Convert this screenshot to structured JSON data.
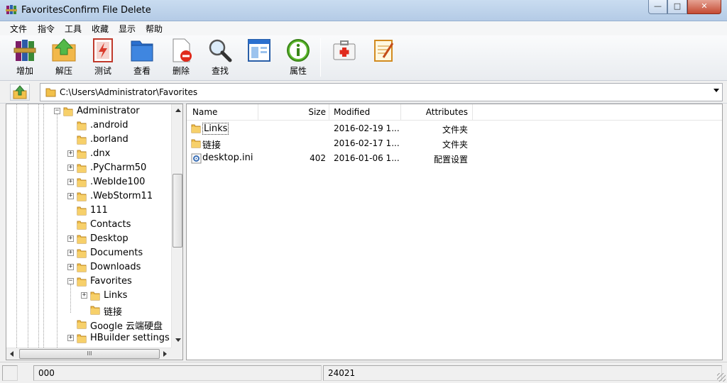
{
  "window": {
    "title": "FavoritesConfirm File Delete"
  },
  "menu": [
    "文件",
    "指令",
    "工具",
    "收藏",
    "显示",
    "帮助"
  ],
  "toolbar": {
    "buttons": [
      {
        "label": "增加",
        "icon": "books-add-icon"
      },
      {
        "label": "解压",
        "icon": "extract-folder-icon"
      },
      {
        "label": "测试",
        "icon": "test-document-icon"
      },
      {
        "label": "查看",
        "icon": "view-book-icon"
      },
      {
        "label": "删除",
        "icon": "delete-document-icon"
      },
      {
        "label": "查找",
        "icon": "magnifier-icon"
      },
      {
        "label": "属性",
        "icon": "info-icon"
      },
      {
        "label": "",
        "icon": "first-aid-kit-icon"
      },
      {
        "label": "",
        "icon": "notepad-icon"
      }
    ]
  },
  "address": {
    "path": "C:\\Users\\Administrator\\Favorites"
  },
  "tree": {
    "items": [
      {
        "name": "Administrator",
        "level": 0,
        "expander": "minus"
      },
      {
        "name": ".android",
        "level": 1,
        "expander": ""
      },
      {
        "name": ".borland",
        "level": 1,
        "expander": ""
      },
      {
        "name": ".dnx",
        "level": 1,
        "expander": "plus"
      },
      {
        "name": ".PyCharm50",
        "level": 1,
        "expander": "plus"
      },
      {
        "name": ".WebIde100",
        "level": 1,
        "expander": "plus"
      },
      {
        "name": ".WebStorm11",
        "level": 1,
        "expander": "plus"
      },
      {
        "name": "111",
        "level": 1,
        "expander": ""
      },
      {
        "name": "Contacts",
        "level": 1,
        "expander": ""
      },
      {
        "name": "Desktop",
        "level": 1,
        "expander": "plus"
      },
      {
        "name": "Documents",
        "level": 1,
        "expander": "plus"
      },
      {
        "name": "Downloads",
        "level": 1,
        "expander": "plus"
      },
      {
        "name": "Favorites",
        "level": 1,
        "expander": "minus"
      },
      {
        "name": "Links",
        "level": 2,
        "expander": "plus"
      },
      {
        "name": "链接",
        "level": 2,
        "expander": ""
      },
      {
        "name": "Google 云端硬盘",
        "level": 1,
        "expander": ""
      },
      {
        "name": "HBuilder settings",
        "level": 1,
        "expander": "plus"
      }
    ],
    "hscroll_glyph": "III"
  },
  "files": {
    "columns": [
      "Name",
      "Size",
      "Modified",
      "Attributes"
    ],
    "rows": [
      {
        "name": "Links",
        "size": "",
        "modified": "2016-02-19 1...",
        "attributes": "文件夹",
        "icon": "folder-icon",
        "selected": true
      },
      {
        "name": "链接",
        "size": "",
        "modified": "2016-02-17 1...",
        "attributes": "文件夹",
        "icon": "folder-icon",
        "selected": false
      },
      {
        "name": "desktop.ini",
        "size": "402",
        "modified": "2016-01-06 1...",
        "attributes": "配置设置",
        "icon": "settings-file-icon",
        "selected": false
      }
    ]
  },
  "status": {
    "left": "000",
    "right": "24021"
  },
  "colors": {
    "titlebar": "#b9cfe8",
    "close": "#c44a32",
    "folder": "#f2c14b"
  }
}
